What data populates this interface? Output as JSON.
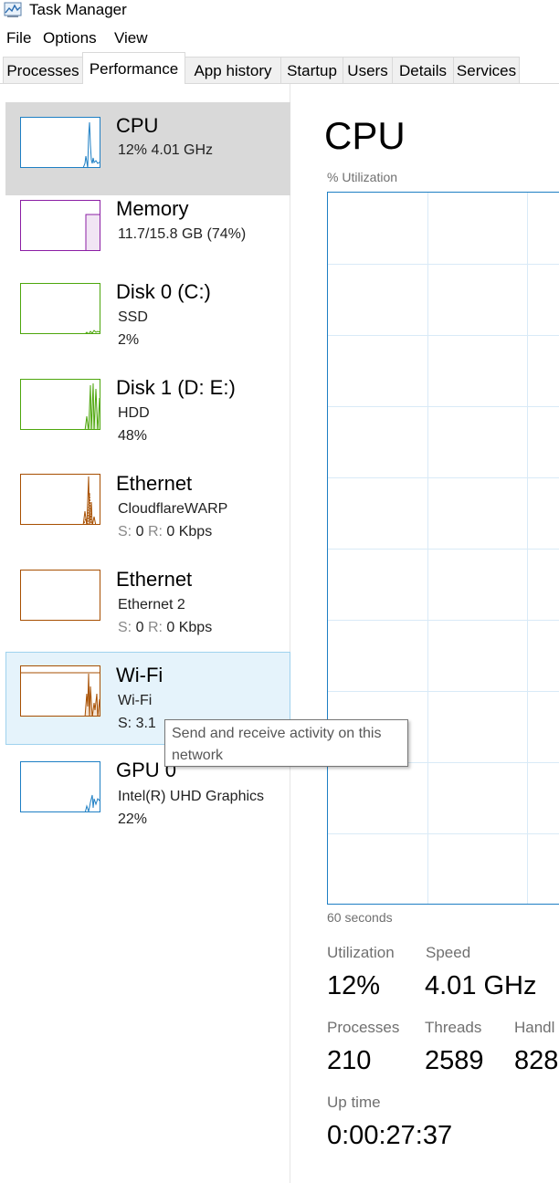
{
  "window": {
    "title": "Task Manager",
    "icon": "task-manager-icon"
  },
  "menu": [
    "File",
    "Options",
    "View"
  ],
  "tabs": [
    "Processes",
    "Performance",
    "App history",
    "Startup",
    "Users",
    "Details",
    "Services"
  ],
  "active_tab": "Performance",
  "sidebar": {
    "items": [
      {
        "name": "CPU",
        "lines": [
          "12%  4.01 GHz"
        ],
        "color": "#1e7fc4"
      },
      {
        "name": "Memory",
        "lines": [
          "11.7/15.8 GB (74%)"
        ],
        "color": "#8b1ea4"
      },
      {
        "name": "Disk 0 (C:)",
        "lines": [
          "SSD",
          "2%"
        ],
        "color": "#4da60c"
      },
      {
        "name": "Disk 1 (D: E:)",
        "lines": [
          "HDD",
          "48%"
        ],
        "color": "#4da60c"
      },
      {
        "name": "Ethernet",
        "lines": [
          "CloudflareWARP"
        ],
        "send_label": "S:",
        "send_value": "0",
        "recv_label": "R:",
        "recv_value": "0 Kbps",
        "color": "#a74f01"
      },
      {
        "name": "Ethernet",
        "lines": [
          "Ethernet 2"
        ],
        "send_label": "S:",
        "send_value": "0",
        "recv_label": "R:",
        "recv_value": "0 Kbps",
        "color": "#a74f01"
      },
      {
        "name": "Wi-Fi",
        "lines": [
          "Wi-Fi",
          "S: 3.1"
        ],
        "color": "#a74f01"
      },
      {
        "name": "GPU 0",
        "lines": [
          "Intel(R) UHD Graphics",
          "22%"
        ],
        "color": "#1e7fc4"
      }
    ]
  },
  "tooltip": {
    "line1": "Send and receive activity on this",
    "line2": "network"
  },
  "main": {
    "title": "CPU",
    "graph_label": "% Utilization",
    "time_label": "60 seconds",
    "stats": {
      "utilization": {
        "label": "Utilization",
        "value": "12%"
      },
      "speed": {
        "label": "Speed",
        "value": "4.01 GHz"
      },
      "processes": {
        "label": "Processes",
        "value": "210"
      },
      "threads": {
        "label": "Threads",
        "value": "2589"
      },
      "handles": {
        "label": "Handl",
        "value": "828"
      },
      "uptime": {
        "label": "Up time",
        "value": "0:00:27:37"
      }
    }
  }
}
